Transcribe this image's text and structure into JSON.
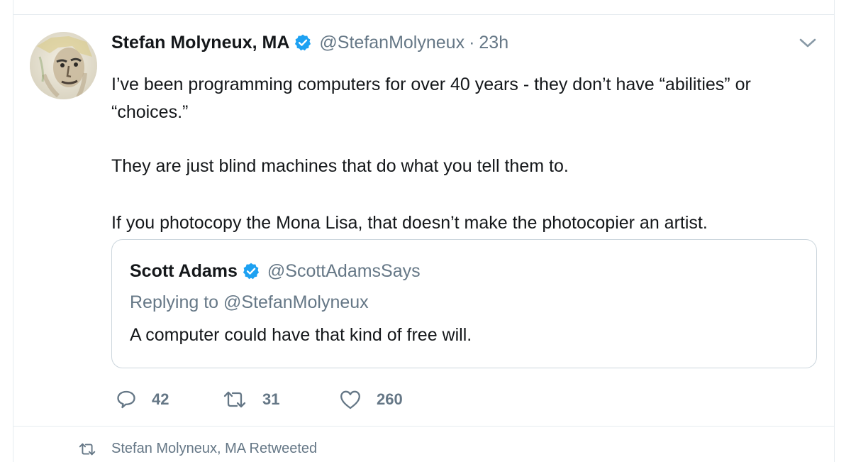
{
  "tweet": {
    "author_name": "Stefan Molyneux, MA",
    "verified": true,
    "handle": "@StefanMolyneux",
    "separator": "·",
    "time": "23h",
    "text_lines": [
      "I’ve been programming computers for over 40 years - they don’t have “abilities” or “choices.”",
      "They are just blind machines that do what you tell them to.",
      "If you photocopy the Mona Lisa, that doesn’t make the photocopier an artist."
    ],
    "quoted": {
      "author_name": "Scott Adams",
      "verified": true,
      "handle": "@ScottAdamsSays",
      "replying_to": "Replying to @StefanMolyneux",
      "text": "A computer could have that kind of free will."
    },
    "actions": {
      "replies": "42",
      "retweets": "31",
      "likes": "260"
    }
  },
  "next_tweet": {
    "retweeted_label": "Stefan Molyneux, MA Retweeted"
  },
  "icons": {
    "verified": "verified-badge-icon",
    "caret": "chevron-down-icon",
    "reply": "reply-icon",
    "retweet": "retweet-icon",
    "like": "heart-icon"
  },
  "colors": {
    "text": "#14171a",
    "secondary": "#657786",
    "verified_blue": "#1da1f2",
    "border": "#e6ecf0"
  }
}
